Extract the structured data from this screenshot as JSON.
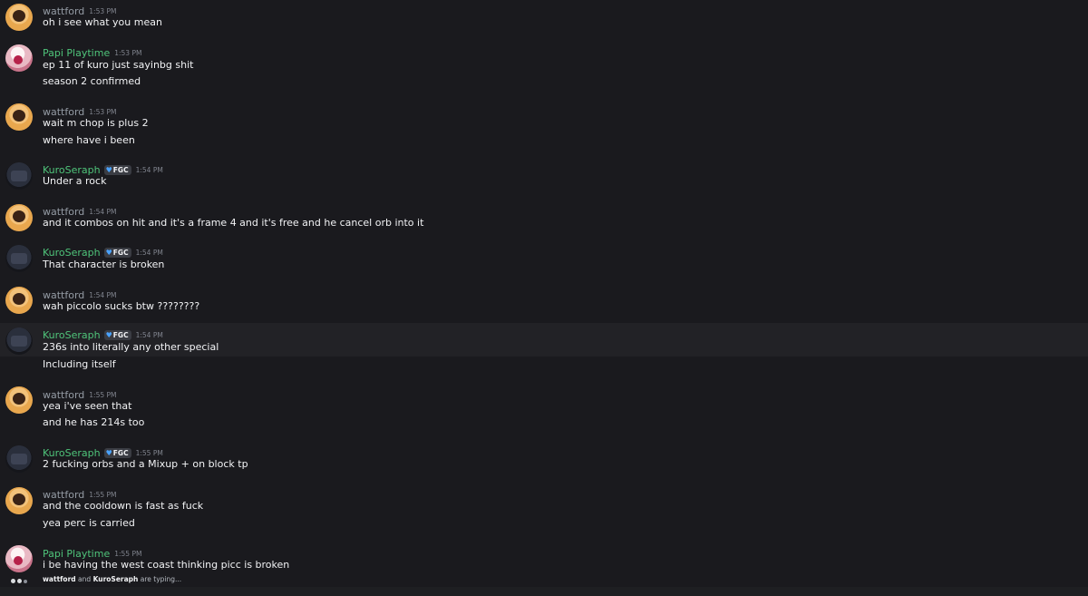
{
  "messages": [
    {
      "author": "wattford",
      "author_color": "#949ba4",
      "avatar": "wattford-avatar",
      "time": "1:53 PM",
      "lines": [
        "oh i see what you mean"
      ]
    },
    {
      "author": "Papi Playtime",
      "author_color": "#4fc47a",
      "avatar": "papi-avatar",
      "time": "1:53 PM",
      "lines": [
        "ep 11 of kuro just sayinbg  shit",
        "season 2 confirmed"
      ]
    },
    {
      "author": "wattford",
      "author_color": "#949ba4",
      "avatar": "wattford-avatar",
      "time": "1:53 PM",
      "lines": [
        "wait m chop is plus 2",
        "where have i been"
      ]
    },
    {
      "author": "KuroSeraph",
      "author_color": "#4fc47a",
      "avatar": "kuro-avatar",
      "tag": "FGC",
      "time": "1:54 PM",
      "lines": [
        "Under a rock"
      ]
    },
    {
      "author": "wattford",
      "author_color": "#949ba4",
      "avatar": "wattford-avatar",
      "time": "1:54 PM",
      "lines": [
        "and it combos on hit and it's a frame 4 and it's free and he cancel orb into it"
      ]
    },
    {
      "author": "KuroSeraph",
      "author_color": "#4fc47a",
      "avatar": "kuro-avatar",
      "tag": "FGC",
      "time": "1:54 PM",
      "lines": [
        "That character is broken"
      ]
    },
    {
      "author": "wattford",
      "author_color": "#949ba4",
      "avatar": "wattford-avatar",
      "time": "1:54 PM",
      "lines": [
        "wah piccolo sucks btw ????????"
      ]
    },
    {
      "author": "KuroSeraph",
      "author_color": "#4fc47a",
      "avatar": "kuro-avatar",
      "tag": "FGC",
      "time": "1:54 PM",
      "lines": [
        "236s into literally any other special",
        "Including itself"
      ]
    },
    {
      "author": "wattford",
      "author_color": "#949ba4",
      "avatar": "wattford-avatar",
      "time": "1:55 PM",
      "lines": [
        "yea i've seen that",
        "and he has 214s too"
      ]
    },
    {
      "author": "KuroSeraph",
      "author_color": "#4fc47a",
      "avatar": "kuro-avatar",
      "tag": "FGC",
      "time": "1:55 PM",
      "lines": [
        "2 fucking orbs and a Mixup + on block tp"
      ]
    },
    {
      "author": "wattford",
      "author_color": "#949ba4",
      "avatar": "wattford-avatar",
      "time": "1:55 PM",
      "lines": [
        "and the cooldown is fast as fuck",
        "yea perc is carried"
      ]
    },
    {
      "author": "Papi Playtime",
      "author_color": "#4fc47a",
      "avatar": "papi-avatar",
      "time": "1:55 PM",
      "lines": [
        "i be having the west coast thinking picc is broken"
      ]
    }
  ],
  "typing": {
    "user1": "wattford",
    "and": "and",
    "user2": "KuroSeraph",
    "suffix": "are typing..."
  }
}
